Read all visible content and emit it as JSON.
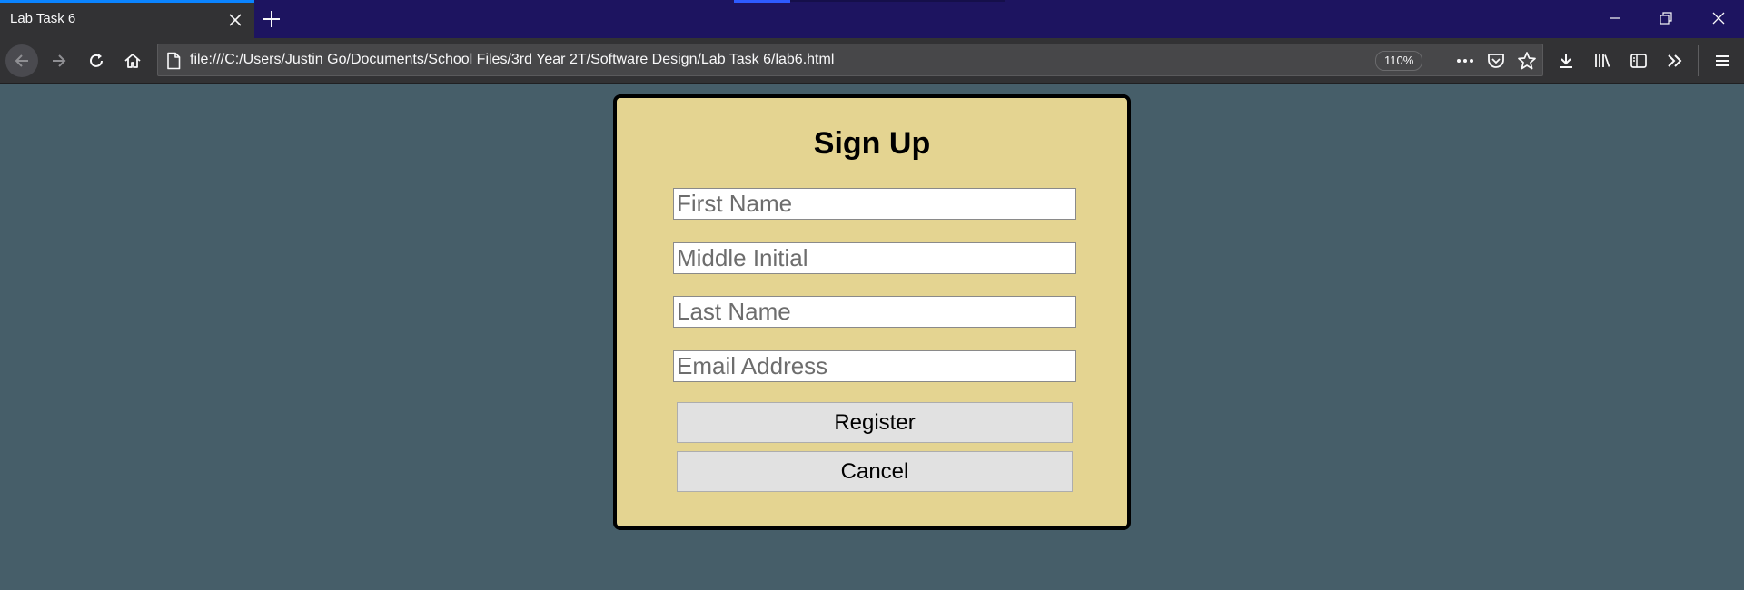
{
  "browser": {
    "tab_title": "Lab Task 6",
    "url": "file:///C:/Users/Justin Go/Documents/School Files/3rd Year 2T/Software Design/Lab Task 6/lab6.html",
    "zoom": "110%",
    "colors": {
      "tabstrip": "#1d1460",
      "toolbar": "#323234",
      "accent": "#0a84ff"
    }
  },
  "page": {
    "background": "#465e69",
    "signup": {
      "title": "Sign Up",
      "fields": {
        "first_name": "First Name",
        "middle_initial": "Middle Initial",
        "last_name": "Last Name",
        "email": "Email Address"
      },
      "buttons": {
        "register": "Register",
        "cancel": "Cancel"
      },
      "card_color": "#e4d491"
    }
  }
}
